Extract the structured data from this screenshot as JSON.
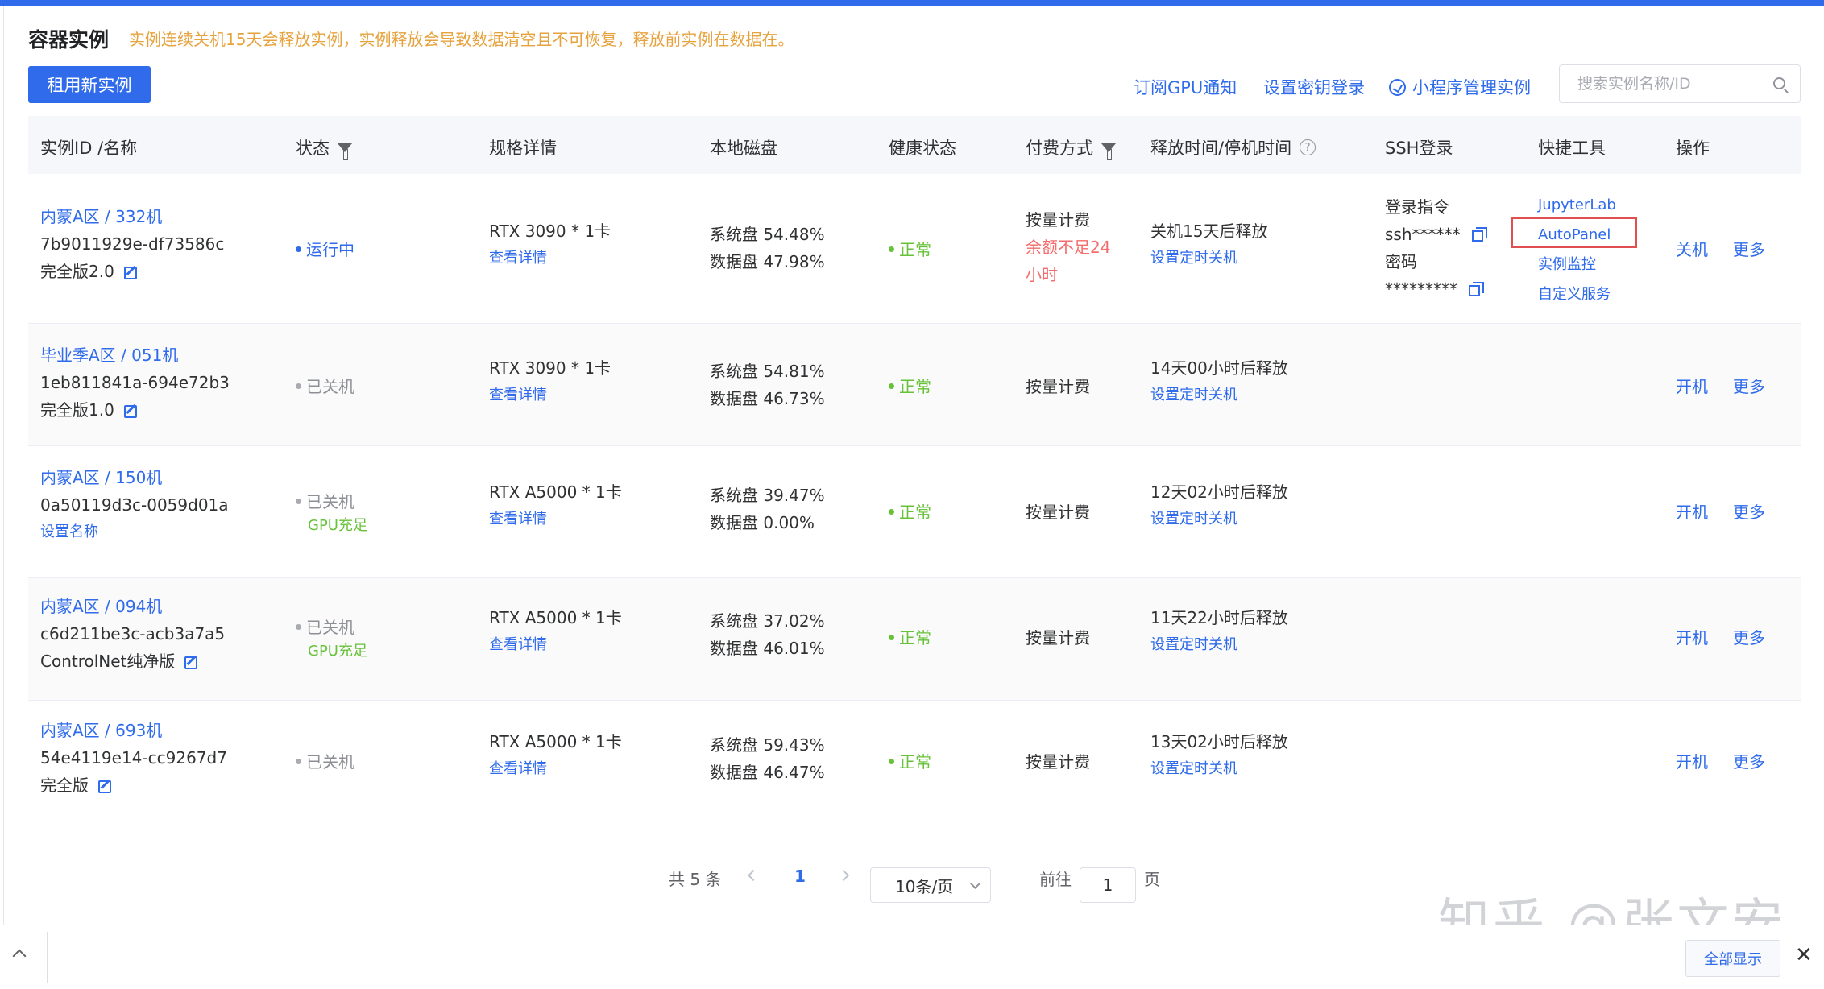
{
  "page": {
    "title": "容器实例",
    "warning": "实例连续关机15天会释放实例，实例释放会导致数据清空且不可恢复，释放前实例在数据在。",
    "rent_button": "租用新实例",
    "links": [
      "订阅GPU通知",
      "设置密钥登录",
      "小程序管理实例"
    ],
    "search_placeholder": "搜索实例名称/ID"
  },
  "columns": [
    "实例ID /名称",
    "状态",
    "规格详情",
    "本地磁盘",
    "健康状态",
    "付费方式",
    "释放时间/停机时间",
    "SSH登录",
    "快捷工具",
    "操作"
  ],
  "rows": [
    {
      "region_name": "内蒙A区 / 332机",
      "id": "7b9011929e-df73586c",
      "name": "完全版2.0",
      "status": "运行中",
      "status_extra": "",
      "gpu": "RTX 3090 * 1卡",
      "detail_link": "查看详情",
      "sys_disk": "系统盘 54.48%",
      "data_disk": "数据盘 47.98%",
      "health": "正常",
      "billing": "按量计费",
      "billing_warn1": "余额不足24",
      "billing_warn2": "小时",
      "release": "关机15天后释放",
      "timer_link": "设置定时关机",
      "ssh_label": "登录指令",
      "ssh_value": "ssh******",
      "pwd_label": "密码",
      "pwd_value": "*********",
      "tools": [
        "JupyterLab",
        "AutoPanel",
        "实例监控",
        "自定义服务"
      ],
      "action": "关机",
      "more": "更多"
    },
    {
      "region_name": "毕业季A区 / 051机",
      "id": "1eb811841a-694e72b3",
      "name": "完全版1.0",
      "status": "已关机",
      "status_extra": "",
      "gpu": "RTX 3090 * 1卡",
      "detail_link": "查看详情",
      "sys_disk": "系统盘 54.81%",
      "data_disk": "数据盘 46.73%",
      "health": "正常",
      "billing": "按量计费",
      "release": "14天00小时后释放",
      "timer_link": "设置定时关机",
      "action": "开机",
      "more": "更多"
    },
    {
      "region_name": "内蒙A区 / 150机",
      "id": "0a50119d3c-0059d01a",
      "name": "设置名称",
      "status": "已关机",
      "status_extra": "GPU充足",
      "gpu": "RTX A5000 * 1卡",
      "detail_link": "查看详情",
      "sys_disk": "系统盘 39.47%",
      "data_disk": "数据盘 0.00%",
      "health": "正常",
      "billing": "按量计费",
      "release": "12天02小时后释放",
      "timer_link": "设置定时关机",
      "action": "开机",
      "more": "更多"
    },
    {
      "region_name": "内蒙A区 / 094机",
      "id": "c6d211be3c-acb3a7a5",
      "name": "ControlNet纯净版",
      "status": "已关机",
      "status_extra": "GPU充足",
      "gpu": "RTX A5000 * 1卡",
      "detail_link": "查看详情",
      "sys_disk": "系统盘 37.02%",
      "data_disk": "数据盘 46.01%",
      "health": "正常",
      "billing": "按量计费",
      "release": "11天22小时后释放",
      "timer_link": "设置定时关机",
      "action": "开机",
      "more": "更多"
    },
    {
      "region_name": "内蒙A区 / 693机",
      "id": "54e4119e14-cc9267d7",
      "name": "完全版",
      "status": "已关机",
      "status_extra": "",
      "gpu": "RTX A5000 * 1卡",
      "detail_link": "查看详情",
      "sys_disk": "系统盘 59.43%",
      "data_disk": "数据盘 46.47%",
      "health": "正常",
      "billing": "按量计费",
      "release": "13天02小时后释放",
      "timer_link": "设置定时关机",
      "action": "开机",
      "more": "更多"
    }
  ],
  "pagination": {
    "total": "共 5 条",
    "current_page": "1",
    "page_size": "10条/页",
    "goto_label": "前往",
    "goto_value": "1",
    "goto_suffix": "页"
  },
  "watermark": "知乎 @张文安",
  "bottom_bar": {
    "show_all": "全部显示",
    "close": "✕"
  },
  "colors": {
    "accent": "#2f6bea",
    "warning": "#e6a23c",
    "success": "#67c23a",
    "danger": "#f56c6c",
    "highlight_box": "#e05050"
  }
}
